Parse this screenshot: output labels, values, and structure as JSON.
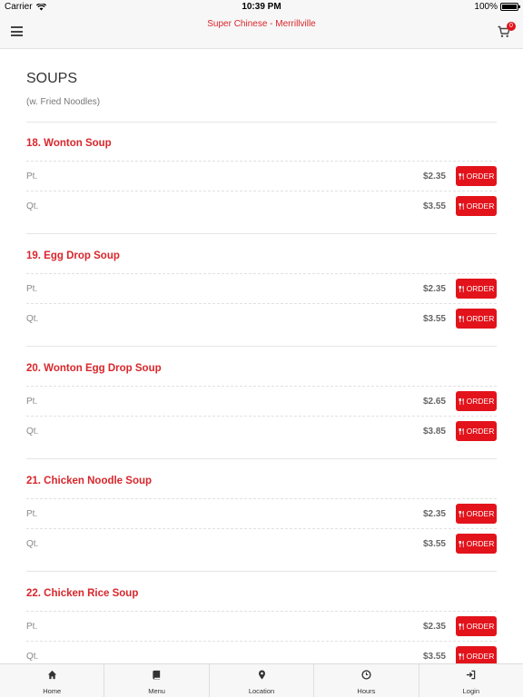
{
  "status_bar": {
    "carrier": "Carrier",
    "time": "10:39 PM",
    "battery": "100%"
  },
  "header": {
    "title": "Super Chinese - Merrillville",
    "cart_count": "0"
  },
  "section": {
    "title": "SOUPS",
    "subtitle": "(w. Fried Noodles)"
  },
  "order_label": "ORDER",
  "items": [
    {
      "name": "18. Wonton Soup",
      "sizes": [
        {
          "label": "Pt.",
          "price": "$2.35"
        },
        {
          "label": "Qt.",
          "price": "$3.55"
        }
      ]
    },
    {
      "name": "19. Egg Drop Soup",
      "sizes": [
        {
          "label": "Pt.",
          "price": "$2.35"
        },
        {
          "label": "Qt.",
          "price": "$3.55"
        }
      ]
    },
    {
      "name": "20. Wonton Egg Drop Soup",
      "sizes": [
        {
          "label": "Pt.",
          "price": "$2.65"
        },
        {
          "label": "Qt.",
          "price": "$3.85"
        }
      ]
    },
    {
      "name": "21. Chicken Noodle Soup",
      "sizes": [
        {
          "label": "Pt.",
          "price": "$2.35"
        },
        {
          "label": "Qt.",
          "price": "$3.55"
        }
      ]
    },
    {
      "name": "22. Chicken Rice Soup",
      "sizes": [
        {
          "label": "Pt.",
          "price": "$2.35"
        },
        {
          "label": "Qt.",
          "price": "$3.55"
        }
      ]
    }
  ],
  "bottom_nav": [
    {
      "label": "Home",
      "icon": "home-icon"
    },
    {
      "label": "Menu",
      "icon": "book-icon"
    },
    {
      "label": "Location",
      "icon": "map-pin-icon"
    },
    {
      "label": "Hours",
      "icon": "clock-icon"
    },
    {
      "label": "Login",
      "icon": "login-icon"
    }
  ],
  "colors": {
    "accent": "#e3131b",
    "title_red": "#d8262b"
  }
}
